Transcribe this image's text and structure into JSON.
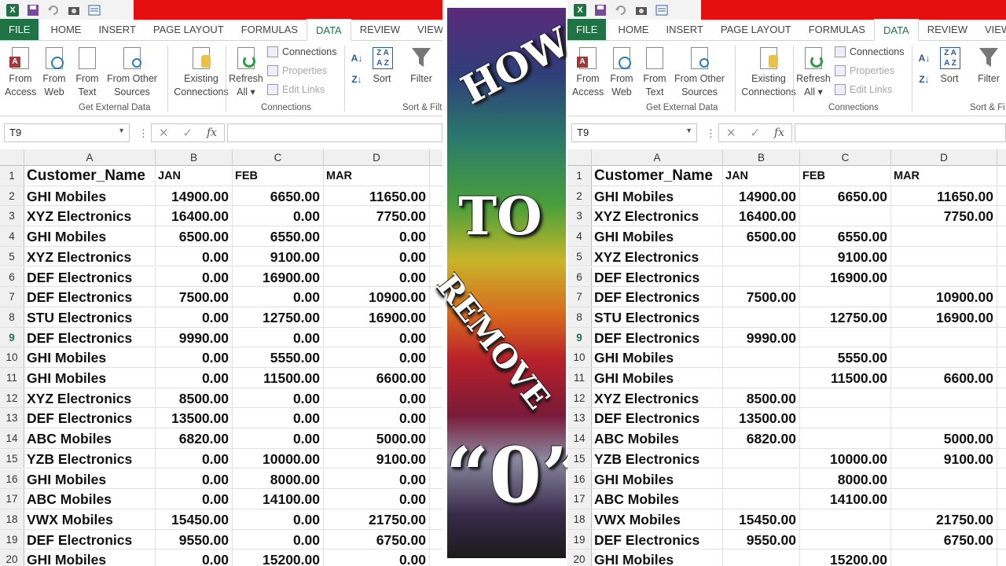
{
  "namebox": "T9",
  "tabs": [
    "FILE",
    "HOME",
    "INSERT",
    "PAGE LAYOUT",
    "FORMULAS",
    "DATA",
    "REVIEW",
    "VIEW"
  ],
  "active_tab": "DATA",
  "ribbon": {
    "from_access_1": "From",
    "from_access_2": "Access",
    "from_web_1": "From",
    "from_web_2": "Web",
    "from_text_1": "From",
    "from_text_2": "Text",
    "from_other_1": "From Other",
    "from_other_2": "Sources",
    "existing_1": "Existing",
    "existing_2": "Connections",
    "group_get_external": "Get External Data",
    "refresh_1": "Refresh",
    "refresh_2": "All",
    "connections": "Connections",
    "properties": "Properties",
    "edit_links": "Edit Links",
    "group_connections": "Connections",
    "sort": "Sort",
    "filter": "Filter",
    "group_sort_left": "Sort & Filt",
    "group_sort_right": "Sort & Fi"
  },
  "columns": [
    "A",
    "B",
    "C",
    "D"
  ],
  "header_row": {
    "name": "Customer_Name",
    "jan": "JAN",
    "feb": "FEB",
    "mar": "MAR"
  },
  "rows_left": [
    {
      "n": "2",
      "name": "GHI Mobiles",
      "b": "14900.00",
      "c": "6650.00",
      "d": "11650.00"
    },
    {
      "n": "3",
      "name": "XYZ Electronics",
      "b": "16400.00",
      "c": "0.00",
      "d": "7750.00"
    },
    {
      "n": "4",
      "name": "GHI Mobiles",
      "b": "6500.00",
      "c": "6550.00",
      "d": "0.00"
    },
    {
      "n": "5",
      "name": "XYZ Electronics",
      "b": "0.00",
      "c": "9100.00",
      "d": "0.00"
    },
    {
      "n": "6",
      "name": "DEF Electronics",
      "b": "0.00",
      "c": "16900.00",
      "d": "0.00"
    },
    {
      "n": "7",
      "name": "DEF Electronics",
      "b": "7500.00",
      "c": "0.00",
      "d": "10900.00"
    },
    {
      "n": "8",
      "name": "STU Electronics",
      "b": "0.00",
      "c": "12750.00",
      "d": "16900.00"
    },
    {
      "n": "9",
      "name": "DEF Electronics",
      "b": "9990.00",
      "c": "0.00",
      "d": "0.00"
    },
    {
      "n": "10",
      "name": "GHI Mobiles",
      "b": "0.00",
      "c": "5550.00",
      "d": "0.00"
    },
    {
      "n": "11",
      "name": "GHI Mobiles",
      "b": "0.00",
      "c": "11500.00",
      "d": "6600.00"
    },
    {
      "n": "12",
      "name": "XYZ Electronics",
      "b": "8500.00",
      "c": "0.00",
      "d": "0.00"
    },
    {
      "n": "13",
      "name": "DEF Electronics",
      "b": "13500.00",
      "c": "0.00",
      "d": "0.00"
    },
    {
      "n": "14",
      "name": "ABC Mobiles",
      "b": "6820.00",
      "c": "0.00",
      "d": "5000.00"
    },
    {
      "n": "15",
      "name": "YZB Electronics",
      "b": "0.00",
      "c": "10000.00",
      "d": "9100.00"
    },
    {
      "n": "16",
      "name": "GHI Mobiles",
      "b": "0.00",
      "c": "8000.00",
      "d": "0.00"
    },
    {
      "n": "17",
      "name": "ABC Mobiles",
      "b": "0.00",
      "c": "14100.00",
      "d": "0.00"
    },
    {
      "n": "18",
      "name": "VWX Mobiles",
      "b": "15450.00",
      "c": "0.00",
      "d": "21750.00"
    },
    {
      "n": "19",
      "name": "DEF Electronics",
      "b": "9550.00",
      "c": "0.00",
      "d": "6750.00"
    },
    {
      "n": "20",
      "name": "GHI Mobiles",
      "b": "0.00",
      "c": "15200.00",
      "d": "0.00"
    }
  ],
  "rows_right": [
    {
      "n": "2",
      "name": "GHI Mobiles",
      "b": "14900.00",
      "c": "6650.00",
      "d": "11650.00"
    },
    {
      "n": "3",
      "name": "XYZ Electronics",
      "b": "16400.00",
      "c": "",
      "d": "7750.00"
    },
    {
      "n": "4",
      "name": "GHI Mobiles",
      "b": "6500.00",
      "c": "6550.00",
      "d": ""
    },
    {
      "n": "5",
      "name": "XYZ Electronics",
      "b": "",
      "c": "9100.00",
      "d": ""
    },
    {
      "n": "6",
      "name": "DEF Electronics",
      "b": "",
      "c": "16900.00",
      "d": ""
    },
    {
      "n": "7",
      "name": "DEF Electronics",
      "b": "7500.00",
      "c": "",
      "d": "10900.00"
    },
    {
      "n": "8",
      "name": "STU Electronics",
      "b": "",
      "c": "12750.00",
      "d": "16900.00"
    },
    {
      "n": "9",
      "name": "DEF Electronics",
      "b": "9990.00",
      "c": "",
      "d": ""
    },
    {
      "n": "10",
      "name": "GHI Mobiles",
      "b": "",
      "c": "5550.00",
      "d": ""
    },
    {
      "n": "11",
      "name": "GHI Mobiles",
      "b": "",
      "c": "11500.00",
      "d": "6600.00"
    },
    {
      "n": "12",
      "name": "XYZ Electronics",
      "b": "8500.00",
      "c": "",
      "d": ""
    },
    {
      "n": "13",
      "name": "DEF Electronics",
      "b": "13500.00",
      "c": "",
      "d": ""
    },
    {
      "n": "14",
      "name": "ABC Mobiles",
      "b": "6820.00",
      "c": "",
      "d": "5000.00"
    },
    {
      "n": "15",
      "name": "YZB Electronics",
      "b": "",
      "c": "10000.00",
      "d": "9100.00"
    },
    {
      "n": "16",
      "name": "GHI Mobiles",
      "b": "",
      "c": "8000.00",
      "d": ""
    },
    {
      "n": "17",
      "name": "ABC Mobiles",
      "b": "",
      "c": "14100.00",
      "d": ""
    },
    {
      "n": "18",
      "name": "VWX Mobiles",
      "b": "15450.00",
      "c": "",
      "d": "21750.00"
    },
    {
      "n": "19",
      "name": "DEF Electronics",
      "b": "9550.00",
      "c": "",
      "d": "6750.00"
    },
    {
      "n": "20",
      "name": "GHI Mobiles",
      "b": "",
      "c": "15200.00",
      "d": ""
    }
  ],
  "selected_row": "9",
  "banner": {
    "how": "HOW",
    "to": "TO",
    "remove": "REMOVE",
    "zero": "“0”"
  },
  "colors": {
    "excel_green": "#217346",
    "title_red": "#e60f0f"
  }
}
